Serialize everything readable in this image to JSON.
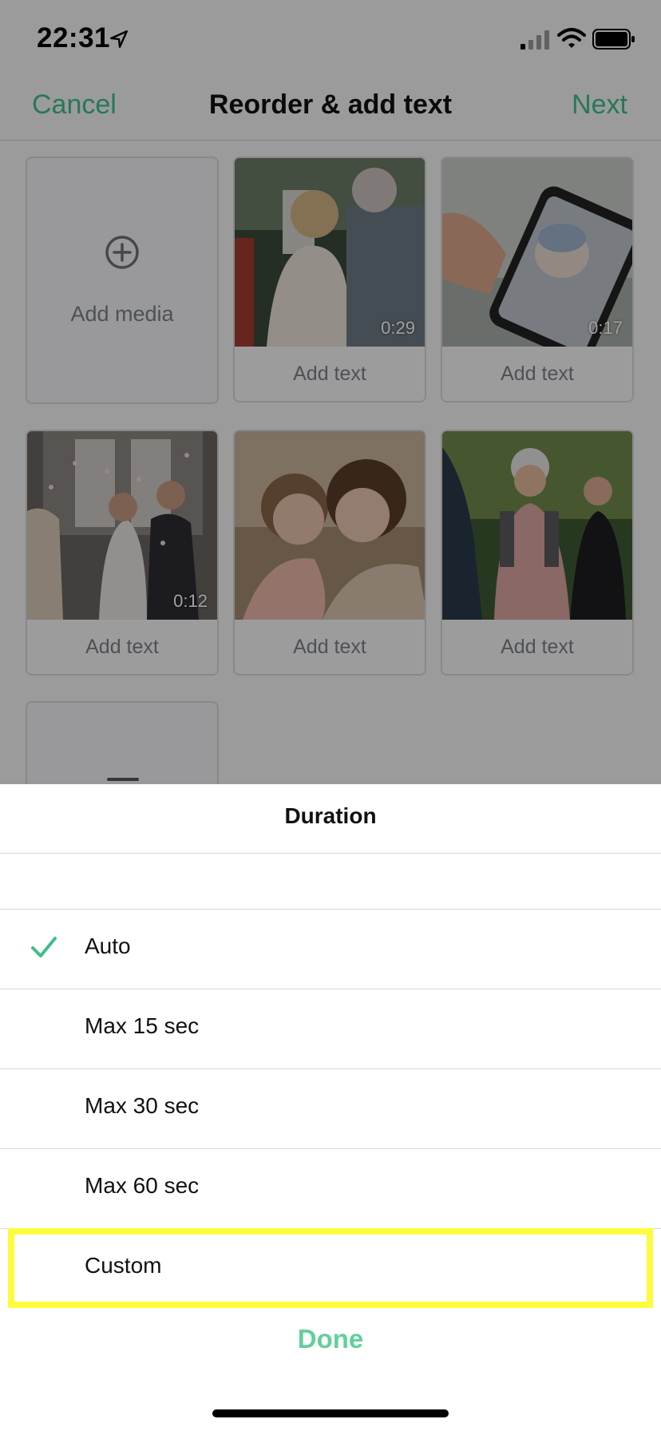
{
  "status_bar": {
    "time": "22:31"
  },
  "nav": {
    "cancel": "Cancel",
    "title": "Reorder & add text",
    "next": "Next"
  },
  "grid": {
    "add_media_label": "Add media",
    "tiles": [
      {
        "caption": "Add text",
        "duration": "0:29"
      },
      {
        "caption": "Add text",
        "duration": "0:17"
      },
      {
        "caption": "Add text",
        "duration": "0:12"
      },
      {
        "caption": "Add text",
        "duration": ""
      },
      {
        "caption": "Add text",
        "duration": ""
      }
    ]
  },
  "sheet": {
    "title": "Duration",
    "options": [
      {
        "label": "Auto",
        "selected": true
      },
      {
        "label": "Max 15 sec",
        "selected": false
      },
      {
        "label": "Max 30 sec",
        "selected": false
      },
      {
        "label": "Max 60 sec",
        "selected": false
      },
      {
        "label": "Custom",
        "selected": false
      }
    ],
    "done": "Done"
  },
  "colors": {
    "accent": "#3dbf88",
    "done": "#63cf9c",
    "highlight": "#fdfb3d"
  }
}
